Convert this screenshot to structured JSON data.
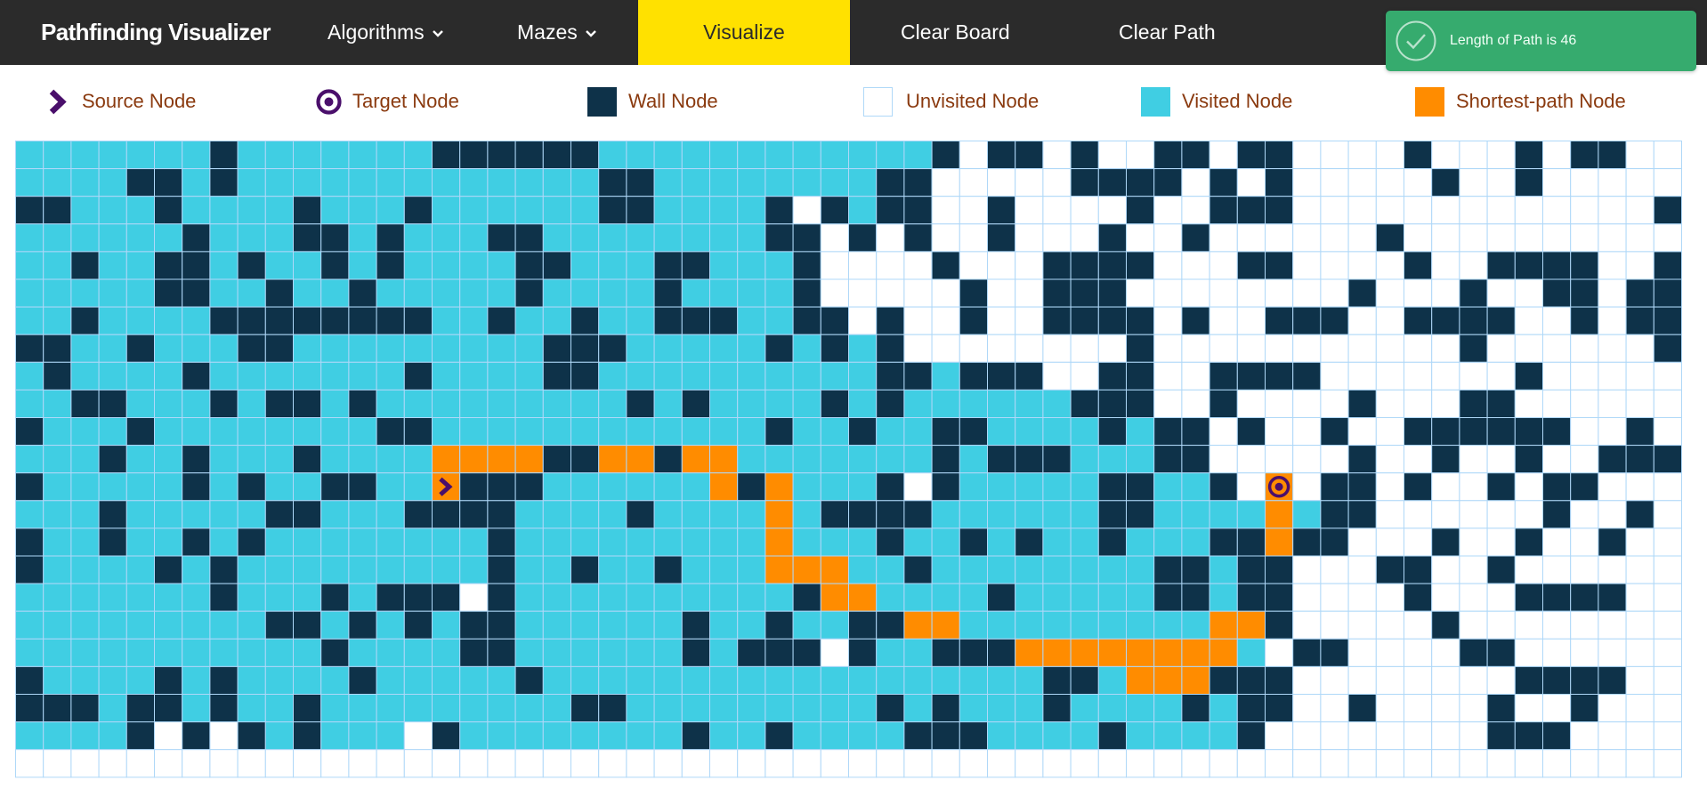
{
  "navbar": {
    "brand": "Pathfinding Visualizer",
    "algorithms_label": "Algorithms",
    "mazes_label": "Mazes",
    "visualize_label": "Visualize",
    "clear_board_label": "Clear Board",
    "clear_path_label": "Clear Path",
    "chevron_icon": "chevron-down-icon"
  },
  "toast": {
    "message": "Length of Path is 46",
    "icon": "check-circle-icon",
    "color": "#36ab6e"
  },
  "legend": {
    "source": "Source Node",
    "target": "Target Node",
    "wall": "Wall Node",
    "unvisited": "Unvisited Node",
    "visited": "Visited Node",
    "shortest": "Shortest-path Node"
  },
  "colors": {
    "navbar": "#2b2b2b",
    "visualize": "#ffe100",
    "wall": "#0e3249",
    "visited": "#40cee3",
    "unvisited": "#ffffff",
    "grid_line": "#afd8f8",
    "shortest": "#ff8c00",
    "node_icon": "#4a0f6b",
    "legend_text": "#8a3a0f"
  },
  "grid": {
    "rows": 23,
    "cols": 60,
    "source": [
      12,
      15
    ],
    "target": [
      12,
      45
    ],
    "cells": [
      "VVVVVVVWVVVVVVVWWWWWWVVVVVVVVVVVVWUWWUWUUWWUWWUUUUWUUUWUWWUU",
      "VVVVWWVWVVVVVVVVVVVVVWWVVVVVVVVWWUUUUUWWWWUWUWUUUUUWUUWUUUUU",
      "WWVVVWVVVVWVVVWVVVVVVWWVVVVWUWVWWUUWUUUUWUUWWWUUUUUUUUUUUUUW",
      "VVVVVVWVVVWWVWVVVWWVVVVVVVVWWUWUWUUWUUUWUUWUUUUUUWUUUUUUUUUU",
      "VVWVVWWVWVVWVWVVVVWWVVVWWVVVWUUUUWUUUWWWWUUUWWUUUUWUUWWWWUUW",
      "VVVVVWWVVWVVWVVVVVWVVVVWVVVVWUUUUUWUUWWWUUUUUUUUWUUUWUUWWUWW",
      "VVWVVVVWWWWWWWWVVWVVWVVWWWVVWWUWUUWUUWWWWUWUUWWWUUWWWWUUWUWW",
      "WWVVWVVVWWVVVVVVVVVWWWVVVVVWVWVWUUUUUUUUWUUUUUUUUUUUWUUUUUUW",
      "VWVVVVWVVVVVVVWVVVVWWVVVVVVVVVVWWVWWWUUWWUUWWWWUUUUUUUWUUUUU",
      "VVWWVVVWVWWVWVVVVVVVVVWVWVVVVWVWVVVVVVWWWUUWUUUUWUUUWWUUUUUU",
      "WVVVWVVVVVVVVWWVVVVVVVVVVVVWVVWVVWWVVVVWVWWUWUUWUUWWWWWWUUWUU",
      "VVVWVVWVVVWVVVVVVVVWWVVWVVVVVVVVVWVWWWVVVWWUUUUUWUUWUUWUUWWWUU",
      "WVVVVVWVWVVWWVVVWWWVVVVVVVWVVVVWUWVVVVVWWVVWUUUWWUWUUWUWWUUUUU",
      "VVVWVVVVVWWVVVWWWWVVVVWVVVVVVWWWWVVVVVVWWVVVVVVWWUUUUUUWUUWUUW",
      "WVVWVVWVWVVVVVVVVWVVVVVVVVVVVVVWVVWVWVVWVVVWWUWWUUUWUUWUUWUU",
      "WVVVVWVWVVVVVVVVVWVVWVVWVVVVVVVVWVVVVVVVVWWVWWUUUWWUUWUUUUUU",
      "VVVVVVVWVVVWVWWWUWVVVVVVVVVVWVVVVVVWVVVVVWWVWWUUUUWUUUWWWWUUUU",
      "VVVVVVVVVWWVWVWVWWVVVVVVWVVWVVWWVVVVVVVVVVVVVWUUUUUWUUUUUUUU",
      "VVVVVVVVVVVWVVVVWWVVVVVVWVWWWUWVVWWWVVVVVVVVVUWWUUUUWWUUUUUU",
      "WVVVVWVWVVVVWVVVVVWVVVVVVVVVVVVVVVVVVWWVVVVWWWUUUUUUUUWWWWUU",
      "WWWVWWVWVVWVVVVVVVVVWWVVVVVVVVVWVWVVVWVVVVWVWWUUWUUUUWUUWUUU",
      "VVVVWUWUWVWVVVUWVVVVVVVVWVVWVVVVWWWVVVVWVVVVWUUUUUUUUWWWUUUU"
    ],
    "path": [
      [
        11,
        15
      ],
      [
        11,
        16
      ],
      [
        11,
        17
      ],
      [
        11,
        18
      ],
      [
        11,
        19
      ],
      [
        11,
        20
      ],
      [
        11,
        21
      ],
      [
        11,
        22
      ],
      [
        11,
        23
      ],
      [
        11,
        24
      ],
      [
        11,
        25
      ],
      [
        12,
        25
      ],
      [
        12,
        26
      ],
      [
        12,
        27
      ],
      [
        13,
        27
      ],
      [
        14,
        27
      ],
      [
        15,
        27
      ],
      [
        15,
        28
      ],
      [
        15,
        29
      ],
      [
        16,
        29
      ],
      [
        16,
        30
      ],
      [
        17,
        30
      ],
      [
        17,
        31
      ],
      [
        17,
        32
      ],
      [
        17,
        33
      ],
      [
        18,
        33
      ],
      [
        18,
        34
      ],
      [
        18,
        35
      ],
      [
        18,
        36
      ],
      [
        18,
        37
      ],
      [
        18,
        38
      ],
      [
        18,
        39
      ],
      [
        18,
        40
      ],
      [
        18,
        41
      ],
      [
        19,
        40
      ],
      [
        19,
        41
      ],
      [
        19,
        42
      ],
      [
        18,
        42
      ],
      [
        18,
        43
      ],
      [
        17,
        43
      ],
      [
        17,
        44
      ],
      [
        16,
        44
      ],
      [
        15,
        44
      ],
      [
        15,
        45
      ],
      [
        14,
        45
      ],
      [
        13,
        45
      ]
    ]
  }
}
